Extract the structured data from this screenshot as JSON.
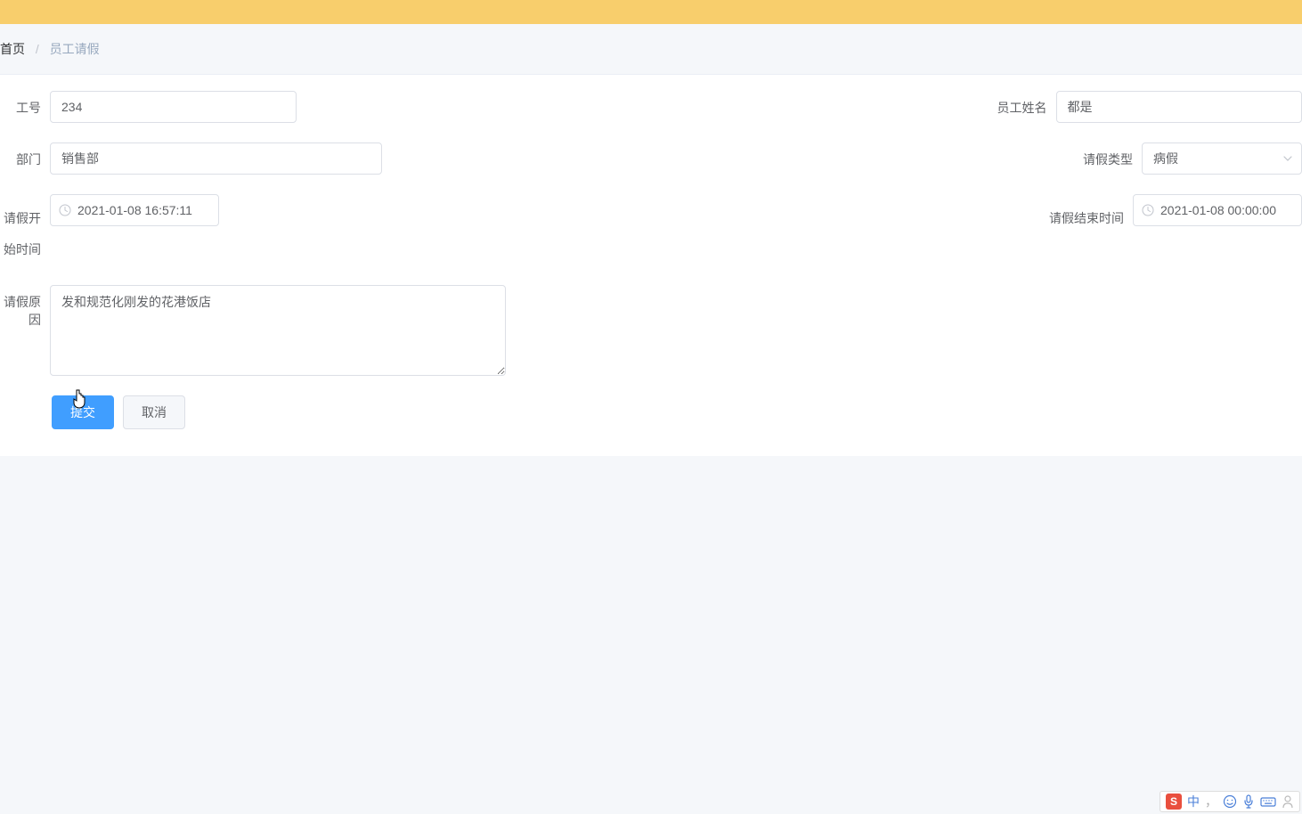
{
  "breadcrumb": {
    "home": "首页",
    "current": "员工请假"
  },
  "form": {
    "employeeId": {
      "label": "工号",
      "value": "234"
    },
    "employeeName": {
      "label": "员工姓名",
      "value": "都是"
    },
    "department": {
      "label": "部门",
      "value": "销售部"
    },
    "leaveType": {
      "label": "请假类型",
      "value": "病假"
    },
    "startTime": {
      "label": "请假开始时间",
      "value": "2021-01-08 16:57:11"
    },
    "endTime": {
      "label": "请假结束时间",
      "value": "2021-01-08 00:00:00"
    },
    "reason": {
      "label": "请假原因",
      "value": "发和规范化刚发的花港饭店"
    }
  },
  "buttons": {
    "submit": "提交",
    "cancel": "取消"
  },
  "ime": {
    "lang": "中",
    "punct": "，",
    "emoji": "☺",
    "mic": "🎤",
    "kbd": "⌨",
    "user": "👤"
  }
}
